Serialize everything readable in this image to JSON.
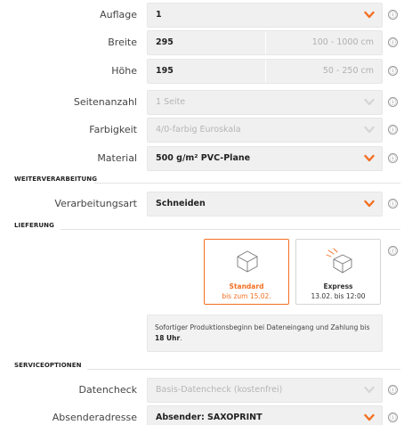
{
  "form": {
    "auflage": {
      "label": "Auflage",
      "value": "1"
    },
    "breite": {
      "label": "Breite",
      "value": "295",
      "range": "100 - 1000 cm"
    },
    "hoehe": {
      "label": "Höhe",
      "value": "195",
      "range": "50 - 250 cm"
    },
    "seitenanzahl": {
      "label": "Seitenanzahl",
      "value": "1 Seite"
    },
    "farbigkeit": {
      "label": "Farbigkeit",
      "value": "4/0-farbig Euroskala"
    },
    "material": {
      "label": "Material",
      "value": "500 g/m² PVC-Plane"
    }
  },
  "weiterverarbeitung": {
    "section_title": "WEITERVERARBEITUNG",
    "verarbeitungsart": {
      "label": "Verarbeitungsart",
      "value": "Schneiden"
    }
  },
  "lieferung": {
    "section_title": "LIEFERUNG",
    "options": [
      {
        "title": "Standard",
        "subtitle": "bis zum 15.02.",
        "selected": true,
        "icon": "box-icon"
      },
      {
        "title": "Express",
        "subtitle": "13.02. bis 12:00",
        "selected": false,
        "icon": "fast-box-icon"
      }
    ],
    "note_text": "Sofortiger Produktionsbeginn bei Dateneingang und Zahlung bis",
    "note_bold": "18 Uhr",
    "note_end": "."
  },
  "serviceoptionen": {
    "section_title": "SERVICEOPTIONEN",
    "datencheck": {
      "label": "Datencheck",
      "value": "Basis-Datencheck (kostenfrei)"
    },
    "absenderadresse": {
      "label": "Absenderadresse",
      "value": "Absender: SAXOPRINT"
    }
  },
  "info_icon": "ⓘ",
  "colors": {
    "accent": "#f36f21",
    "field_bg": "#f0f0f0",
    "disabled_text": "#b5b5b5"
  }
}
